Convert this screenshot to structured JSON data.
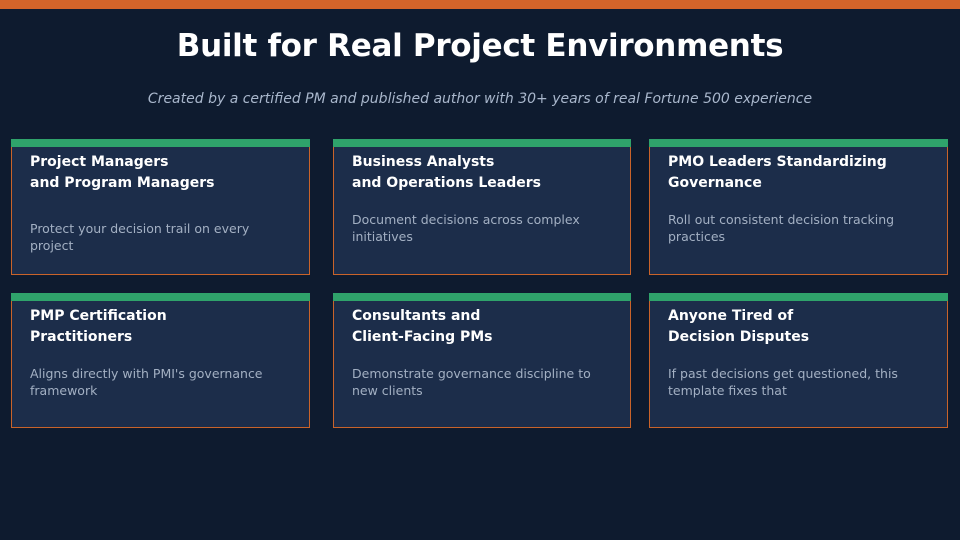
{
  "header": {
    "title": "Built for Real Project Environments",
    "subtitle": "Created by a certified PM and published author with 30+ years of real Fortune 500 experience"
  },
  "colors": {
    "background": "#0e1b2f",
    "accent_top": "#d3642a",
    "card_accent": "#2fa36b",
    "card_border": "#c9632a",
    "card_bg": "#1c2d4a"
  },
  "cards": [
    {
      "title": "Project Managers\nand Program Managers",
      "description": "Protect your decision trail on every project"
    },
    {
      "title": "Business Analysts\nand Operations Leaders",
      "description": "Document decisions across complex initiatives"
    },
    {
      "title": "PMO Leaders Standardizing\nGovernance",
      "description": "Roll out consistent decision tracking practices"
    },
    {
      "title": "PMP Certification\nPractitioners",
      "description": "Aligns directly with PMI's governance framework"
    },
    {
      "title": "Consultants and\nClient-Facing PMs",
      "description": "Demonstrate governance discipline to new clients"
    },
    {
      "title": "Anyone Tired of\nDecision Disputes",
      "description": "If past decisions get questioned, this template fixes that"
    }
  ]
}
